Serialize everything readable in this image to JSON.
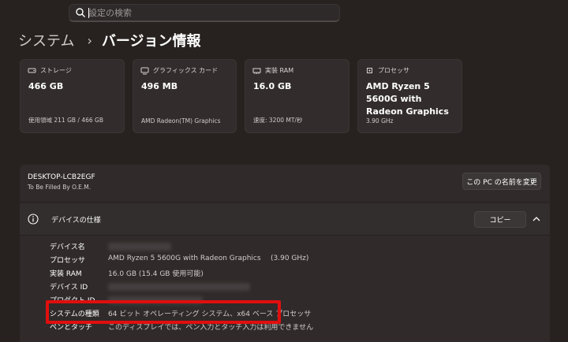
{
  "search": {
    "placeholder": "設定の検索"
  },
  "breadcrumb": {
    "parent": "システム",
    "separator": "›",
    "current": "バージョン情報"
  },
  "cards": [
    {
      "label": "ストレージ",
      "value": "466 GB",
      "sub": "使用領域 211 GB / 466 GB",
      "icon": "storage-icon"
    },
    {
      "label": "グラフィックス カード",
      "value": "496 MB",
      "sub": "AMD Radeon(TM) Graphics",
      "icon": "graphics-card-icon"
    },
    {
      "label": "実装 RAM",
      "value": "16.0 GB",
      "sub": "速度: 3200 MT/秒",
      "icon": "ram-icon"
    },
    {
      "label": "プロセッサ",
      "value": "AMD Ryzen 5 5600G with Radeon Graphics",
      "sub": "3.90 GHz",
      "icon": "processor-icon"
    }
  ],
  "device": {
    "name": "DESKTOP-LCB2EGF",
    "manufacturer": "To Be Filled By O.E.M.",
    "rename_label": "この PC の名前を変更"
  },
  "specs": {
    "title": "デバイスの仕様",
    "copy_label": "コピー",
    "rows": [
      {
        "label": "デバイス名",
        "value": ""
      },
      {
        "label": "プロセッサ",
        "value": "AMD Ryzen 5 5600G with Radeon Graphics",
        "extra": "(3.90 GHz)"
      },
      {
        "label": "実装 RAM",
        "value": "16.0 GB (15.4 GB 使用可能)"
      },
      {
        "label": "デバイス ID",
        "value": ""
      },
      {
        "label": "プロダクト ID",
        "value": ""
      },
      {
        "label": "システムの種類",
        "value": "64 ビット オペレーティング システム、x64 ベース プロセッサ"
      },
      {
        "label": "ペンとタッチ",
        "value": "このディスプレイでは、ペン入力とタッチ入力は利用できません"
      }
    ]
  },
  "colors": {
    "background": "#272220",
    "card": "#322d2c",
    "highlight": "#e10e0e"
  }
}
